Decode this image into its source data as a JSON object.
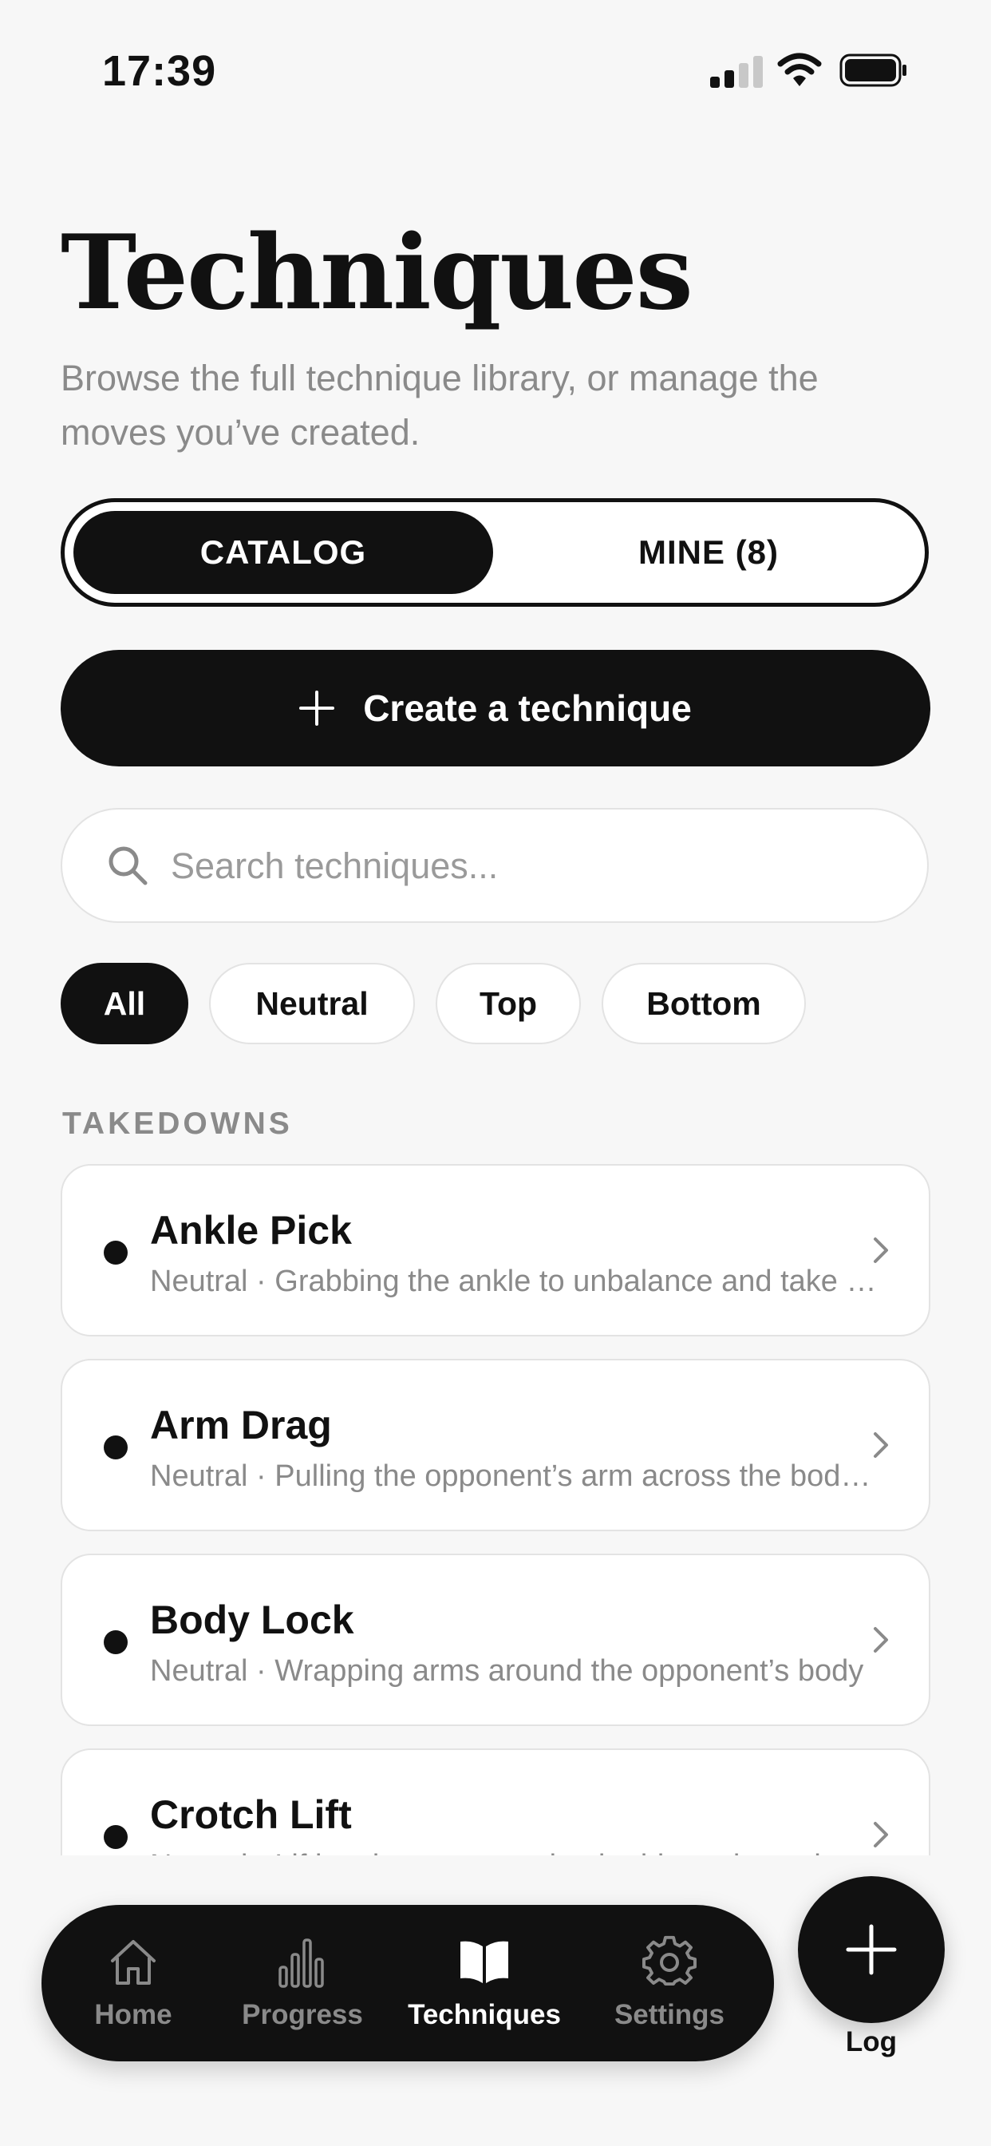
{
  "status_bar": {
    "time": "17:39"
  },
  "header": {
    "title": "Techniques",
    "subtitle": "Browse the full technique library, or manage the moves you’ve created."
  },
  "segmented": {
    "catalog_label": "CATALOG",
    "mine_label": "MINE (8)",
    "selected": "catalog"
  },
  "create_button": {
    "label": "Create a technique"
  },
  "search": {
    "placeholder": "Search techniques...",
    "value": ""
  },
  "filters": {
    "all": "All",
    "neutral": "Neutral",
    "top": "Top",
    "bottom": "Bottom",
    "selected": "All"
  },
  "section": {
    "label": "TAKEDOWNS"
  },
  "techniques": [
    {
      "name": "Ankle Pick",
      "description": "Neutral · Grabbing the ankle to unbalance and take down the opponent"
    },
    {
      "name": "Arm Drag",
      "description": "Neutral · Pulling the opponent’s arm across the body to get behind"
    },
    {
      "name": "Body Lock",
      "description": "Neutral · Wrapping arms around the opponent’s body"
    },
    {
      "name": "Crotch Lift",
      "description": "Neutral · Lifting the opponent by the hip and crotch"
    }
  ],
  "tabbar": {
    "home": "Home",
    "progress": "Progress",
    "techniques": "Techniques",
    "settings": "Settings",
    "active": "Techniques"
  },
  "fab": {
    "label": "Log"
  },
  "colors": {
    "background": "#f7f7f7",
    "primary": "#111111",
    "muted_text": "#8a8a8a",
    "border": "#e3e3e3"
  }
}
